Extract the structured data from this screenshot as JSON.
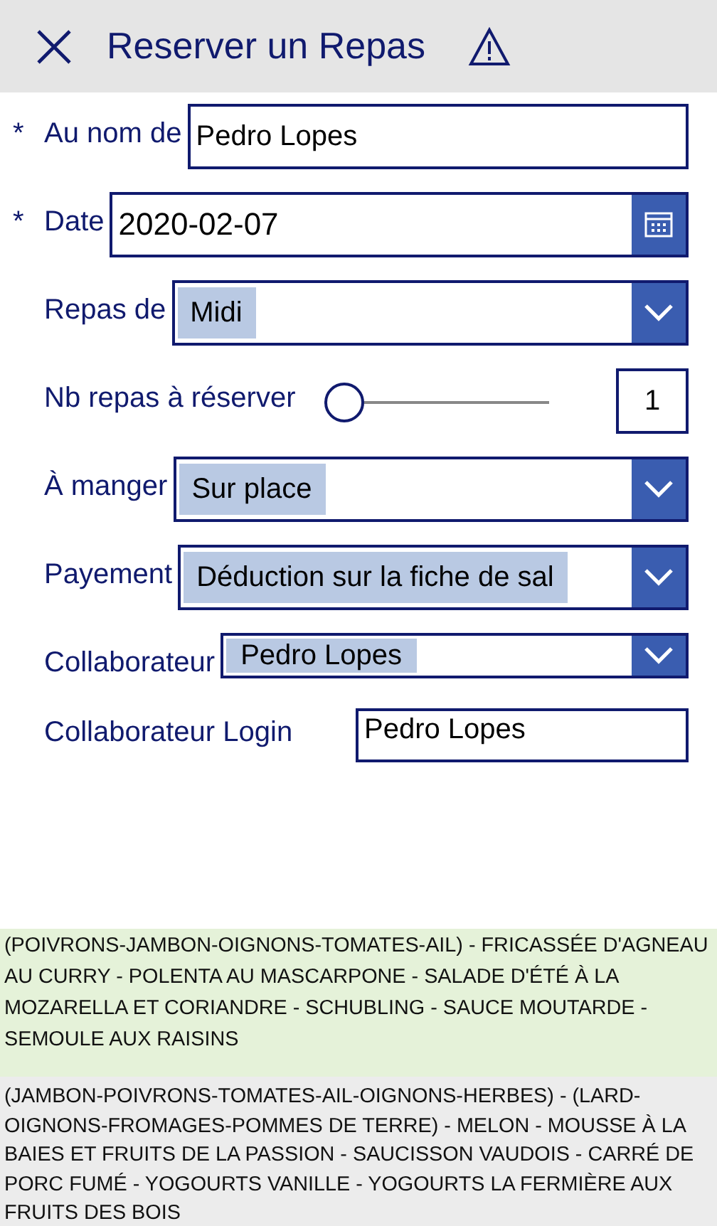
{
  "header": {
    "title": "Reserver un Repas"
  },
  "fields": [
    {
      "kind": "text",
      "required_mark": "*",
      "label": "Au nom de",
      "value": "Pedro Lopes"
    },
    {
      "kind": "date",
      "required_mark": "*",
      "label": "Date",
      "value": "2020-02-07"
    },
    {
      "kind": "dropdown",
      "label": "Repas de",
      "value": "Midi"
    },
    {
      "kind": "slider",
      "label": "Nb repas à réserver",
      "level": 0,
      "value": "1"
    },
    {
      "kind": "dropdown",
      "label": "À manger",
      "value": "Sur place"
    },
    {
      "kind": "dropdown",
      "label": "Payement",
      "value": "Déduction sur la fiche de sal"
    },
    {
      "kind": "dropdown",
      "label": "Collaborateur",
      "value": "Pedro Lopes"
    },
    {
      "kind": "text",
      "label": "Collaborateur Login",
      "value": "Pedro Lopes"
    }
  ],
  "menus": [
    {
      "text": "(POIVRONS-JAMBON-OIGNONS-TOMATES-AIL) - FRICASSÉE D'AGNEAU AU CURRY - POLENTA AU MASCARPONE - SALADE D'ÉTÉ À LA MOZARELLA ET CORIANDRE - SCHUBLING - SAUCE MOUTARDE - SEMOULE AUX RAISINS",
      "selected": true
    },
    {
      "text": "(JAMBON-POIVRONS-TOMATES-AIL-OIGNONS-HERBES) - (LARD-OIGNONS-FROMAGES-POMMES DE TERRE) - MELON - MOUSSE À LA BAIES ET FRUITS DE LA PASSION - SAUCISSON VAUDOIS - CARRÉ DE PORC FUMÉ - YOGOURTS VANILLE - YOGOURTS LA FERMIÈRE AUX FRUITS DES BOIS",
      "selected": false
    }
  ]
}
